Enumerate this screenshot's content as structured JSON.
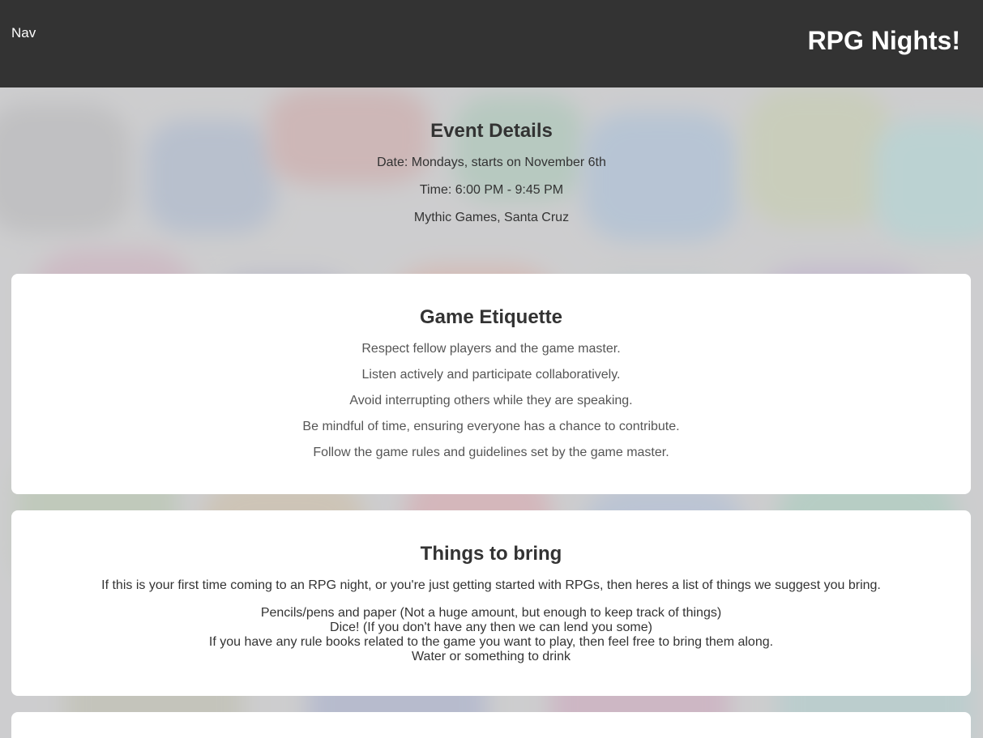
{
  "header": {
    "nav_label": "Nav",
    "title": "RPG Nights!"
  },
  "event": {
    "heading": "Event Details",
    "date": "Date: Mondays, starts on November 6th",
    "time": "Time: 6:00 PM - 9:45 PM",
    "location": "Mythic Games, Santa Cruz"
  },
  "etiquette": {
    "heading": "Game Etiquette",
    "rules": [
      "Respect fellow players and the game master.",
      "Listen actively and participate collaboratively.",
      "Avoid interrupting others while they are speaking.",
      "Be mindful of time, ensuring everyone has a chance to contribute.",
      "Follow the game rules and guidelines set by the game master."
    ]
  },
  "bring": {
    "heading": "Things to bring",
    "intro": "If this is your first time coming to an RPG night, or you're just getting started with RPGs, then heres a list of things we suggest you bring.",
    "items": [
      "Pencils/pens and paper (Not a huge amount, but enough to keep track of things)",
      "Dice! (If you don't have any then we can lend you some)",
      "If you have any rule books related to the game you want to play, then feel free to bring them along.",
      "Water or something to drink"
    ]
  },
  "colors": {
    "header_bg": "#333333",
    "card_bg": "#ffffff",
    "text": "#333333"
  }
}
